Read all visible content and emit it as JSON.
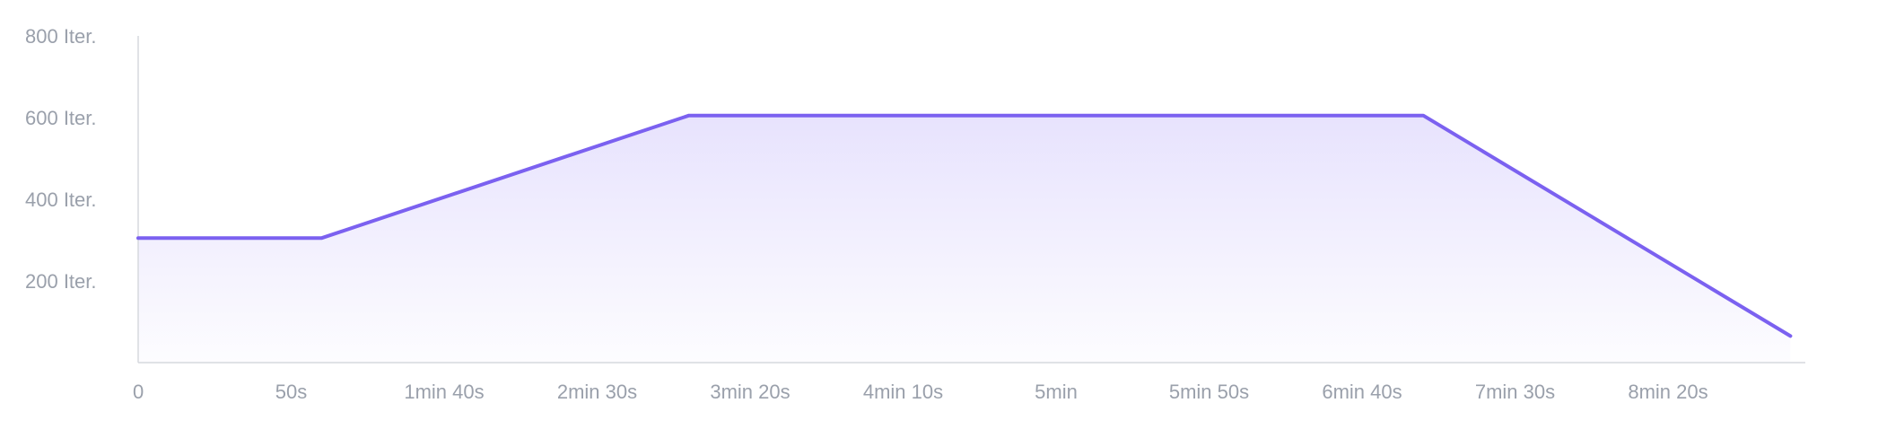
{
  "chart_data": {
    "type": "area",
    "title": "",
    "xlabel": "",
    "ylabel": "",
    "x_unit": "seconds",
    "xlim": [
      0,
      545
    ],
    "ylim": [
      0,
      800
    ],
    "x_ticks": [
      {
        "value": 0,
        "label": "0"
      },
      {
        "value": 50,
        "label": "50s"
      },
      {
        "value": 100,
        "label": "1min 40s"
      },
      {
        "value": 150,
        "label": "2min 30s"
      },
      {
        "value": 200,
        "label": "3min 20s"
      },
      {
        "value": 250,
        "label": "4min 10s"
      },
      {
        "value": 300,
        "label": "5min"
      },
      {
        "value": 350,
        "label": "5min 50s"
      },
      {
        "value": 400,
        "label": "6min 40s"
      },
      {
        "value": 450,
        "label": "7min 30s"
      },
      {
        "value": 500,
        "label": "8min 20s"
      }
    ],
    "y_ticks": [
      {
        "value": 200,
        "label": "200 Iter."
      },
      {
        "value": 400,
        "label": "400 Iter."
      },
      {
        "value": 600,
        "label": "600 Iter."
      },
      {
        "value": 800,
        "label": "800 Iter."
      }
    ],
    "series": [
      {
        "color": "#7b61f0",
        "fill_color": "#e6e1fd",
        "points": [
          {
            "x": 0,
            "y": 305
          },
          {
            "x": 60,
            "y": 305
          },
          {
            "x": 180,
            "y": 605
          },
          {
            "x": 420,
            "y": 605
          },
          {
            "x": 540,
            "y": 65
          }
        ]
      }
    ],
    "grid": false,
    "legend": "none"
  }
}
